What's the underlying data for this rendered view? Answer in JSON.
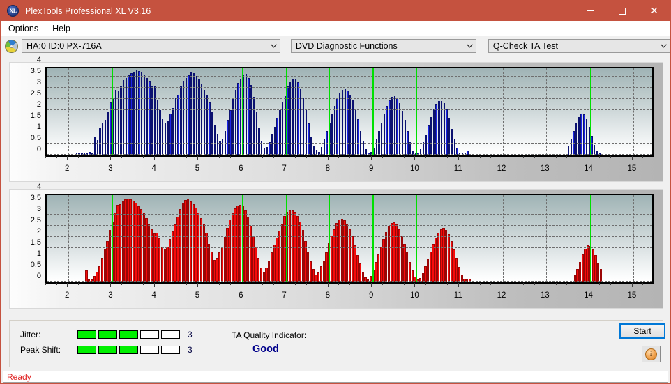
{
  "window": {
    "title": "PlexTools Professional XL V3.16",
    "icon": "xl-logo-icon",
    "icon_text": "XL",
    "accent_color": "#c5523f",
    "buttons": {
      "minimize": "—",
      "maximize": "□",
      "close": "✕"
    }
  },
  "menu": {
    "items": [
      {
        "label": "Options"
      },
      {
        "label": "Help"
      }
    ]
  },
  "toolbar": {
    "drive_icon": "disc-icon",
    "drive_select": {
      "value": "HA:0 ID:0  PX-716A",
      "arrow": "⌄"
    },
    "function_select": {
      "value": "DVD Diagnostic Functions",
      "arrow": "⌄"
    },
    "test_select": {
      "value": "Q-Check TA Test",
      "arrow": "⌄"
    }
  },
  "charts": [
    {
      "name": "ta-test-chart-top",
      "series_color": "#1b24e8",
      "border_color": "#0b1170"
    },
    {
      "name": "ta-test-chart-bottom",
      "series_color": "#f60b0b",
      "border_color": "#9b0606"
    }
  ],
  "chart_data": [
    {
      "type": "bar",
      "name": "jitter-top-chart",
      "title": "",
      "xlabel": "",
      "ylabel": "",
      "color": "#1b24e8",
      "xlim": [
        1.5,
        15.5
      ],
      "ylim": [
        0,
        4
      ],
      "yticks": [
        0,
        0.5,
        1,
        1.5,
        2,
        2.5,
        3,
        3.5,
        4
      ],
      "ytick_labels": [
        "0",
        "0.5",
        "1",
        "1.5",
        "2",
        "2.5",
        "3",
        "3.5",
        "4"
      ],
      "xticks": [
        2,
        3,
        4,
        5,
        6,
        7,
        8,
        9,
        10,
        11,
        12,
        13,
        14,
        15
      ],
      "xtick_labels": [
        "2",
        "3",
        "4",
        "5",
        "6",
        "7",
        "8",
        "9",
        "10",
        "11",
        "12",
        "13",
        "14",
        "15"
      ],
      "grid": true,
      "markers": [
        3,
        4,
        5,
        6,
        7,
        8,
        9,
        10,
        11,
        14
      ],
      "marker_color": "#00e000",
      "bar_gap": true,
      "x": [
        2.2,
        2.26,
        2.32,
        2.38,
        2.44,
        2.5,
        2.56,
        2.62,
        2.68,
        2.74,
        2.8,
        2.86,
        2.92,
        2.98,
        3.04,
        3.1,
        3.16,
        3.22,
        3.28,
        3.34,
        3.4,
        3.46,
        3.52,
        3.58,
        3.64,
        3.7,
        3.76,
        3.82,
        3.88,
        3.94,
        4.0,
        4.06,
        4.12,
        4.18,
        4.24,
        4.3,
        4.36,
        4.42,
        4.48,
        4.54,
        4.6,
        4.66,
        4.72,
        4.78,
        4.84,
        4.9,
        4.96,
        5.02,
        5.08,
        5.14,
        5.2,
        5.26,
        5.32,
        5.38,
        5.44,
        5.5,
        5.56,
        5.62,
        5.68,
        5.74,
        5.8,
        5.86,
        5.92,
        5.98,
        6.04,
        6.1,
        6.16,
        6.22,
        6.28,
        6.34,
        6.4,
        6.46,
        6.52,
        6.58,
        6.64,
        6.7,
        6.76,
        6.82,
        6.88,
        6.94,
        7.0,
        7.06,
        7.12,
        7.18,
        7.24,
        7.3,
        7.36,
        7.42,
        7.48,
        7.54,
        7.6,
        7.66,
        7.72,
        7.78,
        7.84,
        7.9,
        7.96,
        8.02,
        8.08,
        8.14,
        8.2,
        8.26,
        8.32,
        8.38,
        8.44,
        8.5,
        8.56,
        8.62,
        8.68,
        8.74,
        8.8,
        8.86,
        8.92,
        8.98,
        9.04,
        9.1,
        9.16,
        9.22,
        9.28,
        9.34,
        9.4,
        9.46,
        9.52,
        9.58,
        9.64,
        9.7,
        9.76,
        9.82,
        9.88,
        9.94,
        10.0,
        10.06,
        10.12,
        10.18,
        10.24,
        10.3,
        10.36,
        10.42,
        10.48,
        10.54,
        10.6,
        10.66,
        10.72,
        10.78,
        10.84,
        10.9,
        10.96,
        11.02,
        11.08,
        11.14,
        11.2,
        13.52,
        13.58,
        13.64,
        13.7,
        13.76,
        13.82,
        13.88,
        13.94,
        14.0,
        14.06,
        14.12,
        14.18,
        14.24
      ],
      "values": [
        0.05,
        0.04,
        0.03,
        0.06,
        0.05,
        0.12,
        0.1,
        0.8,
        0.65,
        1.2,
        1.45,
        1.55,
        1.95,
        2.35,
        2.55,
        2.9,
        2.85,
        3.1,
        3.35,
        3.45,
        3.55,
        3.65,
        3.72,
        3.78,
        3.75,
        3.7,
        3.58,
        3.45,
        3.3,
        3.08,
        3.05,
        2.45,
        2.0,
        1.6,
        1.45,
        1.5,
        1.85,
        2.1,
        2.55,
        2.7,
        3.05,
        3.3,
        3.45,
        3.55,
        3.68,
        3.65,
        3.52,
        3.38,
        3.18,
        2.9,
        2.65,
        2.35,
        1.95,
        1.35,
        0.95,
        0.62,
        0.68,
        1.05,
        1.55,
        2.0,
        2.55,
        2.9,
        3.22,
        3.42,
        3.58,
        3.62,
        3.45,
        3.12,
        2.6,
        1.95,
        1.2,
        0.62,
        0.3,
        0.35,
        0.55,
        0.95,
        1.25,
        1.65,
        2.0,
        2.35,
        2.62,
        3.05,
        3.28,
        3.4,
        3.38,
        3.25,
        2.95,
        2.55,
        2.05,
        1.4,
        0.8,
        0.4,
        0.22,
        0.12,
        0.35,
        0.7,
        1.05,
        1.4,
        1.85,
        2.2,
        2.55,
        2.78,
        2.92,
        2.98,
        2.88,
        2.7,
        2.45,
        2.05,
        1.6,
        1.05,
        0.58,
        0.25,
        0.08,
        0.12,
        0.3,
        0.68,
        1.05,
        1.45,
        1.85,
        2.2,
        2.45,
        2.58,
        2.62,
        2.52,
        2.3,
        1.98,
        1.55,
        1.05,
        0.55,
        0.18,
        0.05,
        0.1,
        0.25,
        0.55,
        0.92,
        1.3,
        1.7,
        2.05,
        2.28,
        2.42,
        2.42,
        2.3,
        2.02,
        1.62,
        1.15,
        0.7,
        0.3,
        0.1,
        0.05,
        0.08,
        0.18,
        0.4,
        0.7,
        1.05,
        1.4,
        1.7,
        1.85,
        1.8,
        1.6,
        1.25,
        0.85,
        0.45,
        0.18,
        0.05
      ]
    },
    {
      "type": "bar",
      "name": "peak-shift-bottom-chart",
      "title": "",
      "xlabel": "",
      "ylabel": "",
      "color": "#f60b0b",
      "xlim": [
        1.5,
        15.5
      ],
      "ylim": [
        0,
        4
      ],
      "yticks": [
        0,
        0.5,
        1,
        1.5,
        2,
        2.5,
        3,
        3.5,
        4
      ],
      "ytick_labels": [
        "0",
        "0.5",
        "1",
        "1.5",
        "2",
        "2.5",
        "3",
        "3.5",
        "4"
      ],
      "xticks": [
        2,
        3,
        4,
        5,
        6,
        7,
        8,
        9,
        10,
        11,
        12,
        13,
        14,
        15
      ],
      "xtick_labels": [
        "2",
        "3",
        "4",
        "5",
        "6",
        "7",
        "8",
        "9",
        "10",
        "11",
        "12",
        "13",
        "14",
        "15"
      ],
      "grid": true,
      "markers": [
        3,
        4,
        5,
        6,
        7,
        8,
        9,
        10,
        11,
        14
      ],
      "marker_color": "#00e000",
      "bar_gap": false,
      "x": [
        2.42,
        2.48,
        2.54,
        2.6,
        2.66,
        2.72,
        2.78,
        2.84,
        2.9,
        2.96,
        3.02,
        3.08,
        3.14,
        3.2,
        3.26,
        3.32,
        3.38,
        3.44,
        3.5,
        3.56,
        3.62,
        3.68,
        3.74,
        3.8,
        3.86,
        3.92,
        3.98,
        4.04,
        4.1,
        4.16,
        4.22,
        4.28,
        4.34,
        4.4,
        4.46,
        4.52,
        4.58,
        4.64,
        4.7,
        4.76,
        4.82,
        4.88,
        4.94,
        5.0,
        5.06,
        5.12,
        5.18,
        5.24,
        5.3,
        5.36,
        5.42,
        5.48,
        5.54,
        5.6,
        5.66,
        5.72,
        5.78,
        5.84,
        5.9,
        5.96,
        6.02,
        6.08,
        6.14,
        6.2,
        6.26,
        6.32,
        6.38,
        6.44,
        6.5,
        6.56,
        6.62,
        6.68,
        6.74,
        6.8,
        6.86,
        6.92,
        6.98,
        7.04,
        7.1,
        7.16,
        7.22,
        7.28,
        7.34,
        7.4,
        7.46,
        7.52,
        7.58,
        7.64,
        7.7,
        7.76,
        7.82,
        7.88,
        7.94,
        8.0,
        8.06,
        8.12,
        8.18,
        8.24,
        8.3,
        8.36,
        8.42,
        8.48,
        8.54,
        8.6,
        8.66,
        8.72,
        8.78,
        8.84,
        8.9,
        8.96,
        9.02,
        9.08,
        9.14,
        9.2,
        9.26,
        9.32,
        9.38,
        9.44,
        9.5,
        9.56,
        9.62,
        9.68,
        9.74,
        9.8,
        9.86,
        9.92,
        9.98,
        10.04,
        10.1,
        10.16,
        10.22,
        10.28,
        10.34,
        10.4,
        10.46,
        10.52,
        10.58,
        10.64,
        10.7,
        10.76,
        10.82,
        10.88,
        10.94,
        11.0,
        11.06,
        11.12,
        11.18,
        11.24,
        13.66,
        13.72,
        13.78,
        13.84,
        13.9,
        13.96,
        14.02,
        14.08,
        14.14,
        14.2,
        14.26
      ],
      "values": [
        0.5,
        0.08,
        0.1,
        0.25,
        0.45,
        0.7,
        1.05,
        1.45,
        1.8,
        2.3,
        2.65,
        3.1,
        3.45,
        3.48,
        3.62,
        3.7,
        3.72,
        3.68,
        3.62,
        3.52,
        3.38,
        3.25,
        3.05,
        2.85,
        2.6,
        2.35,
        2.15,
        2.2,
        1.95,
        1.52,
        1.48,
        1.55,
        1.9,
        2.25,
        2.55,
        2.9,
        3.25,
        3.5,
        3.65,
        3.68,
        3.6,
        3.48,
        3.32,
        3.1,
        2.85,
        2.58,
        2.18,
        1.68,
        1.35,
        0.98,
        1.05,
        1.3,
        1.55,
        2.0,
        2.4,
        2.78,
        3.05,
        3.28,
        3.42,
        3.45,
        3.38,
        3.2,
        2.92,
        2.5,
        2.05,
        1.55,
        1.05,
        0.62,
        0.45,
        0.62,
        0.95,
        1.3,
        1.65,
        1.98,
        2.28,
        2.55,
        2.95,
        3.12,
        3.18,
        3.2,
        3.12,
        2.95,
        2.68,
        2.3,
        1.82,
        1.35,
        0.92,
        0.55,
        0.3,
        0.4,
        0.68,
        0.95,
        1.32,
        1.72,
        2.05,
        2.35,
        2.62,
        2.78,
        2.82,
        2.75,
        2.6,
        2.35,
        2.02,
        1.62,
        1.18,
        0.8,
        0.45,
        0.2,
        0.1,
        0.25,
        0.52,
        0.88,
        1.22,
        1.55,
        1.92,
        2.22,
        2.48,
        2.62,
        2.65,
        2.55,
        2.35,
        2.05,
        1.7,
        1.3,
        0.88,
        0.5,
        0.22,
        0.08,
        0.15,
        0.38,
        0.7,
        1.02,
        1.35,
        1.68,
        1.98,
        2.2,
        2.35,
        2.4,
        2.32,
        2.12,
        1.82,
        1.45,
        1.05,
        0.65,
        0.32,
        0.12,
        0.08,
        0.12,
        0.28,
        0.55,
        0.88,
        1.22,
        1.48,
        1.62,
        1.6,
        1.45,
        1.18,
        0.85,
        0.55,
        0.28,
        0.1,
        0.08,
        0.12,
        0.3,
        0.62,
        0.95,
        1.12,
        1.05,
        0.78,
        1.05,
        1.18,
        0.9,
        0.62,
        0.38,
        0.15
      ]
    }
  ],
  "results": {
    "jitter": {
      "label": "Jitter:",
      "segments": [
        true,
        true,
        true,
        false,
        false
      ],
      "value": "3"
    },
    "peak_shift": {
      "label": "Peak Shift:",
      "segments": [
        true,
        true,
        true,
        false,
        false
      ],
      "value": "3"
    },
    "segment_on_color": "#00f000",
    "ta_quality": {
      "label": "TA Quality Indicator:",
      "value": "Good",
      "value_color": "#00008b"
    },
    "start_button": "Start",
    "info_button": "i"
  },
  "status": {
    "text": "Ready",
    "color": "#e02020"
  }
}
